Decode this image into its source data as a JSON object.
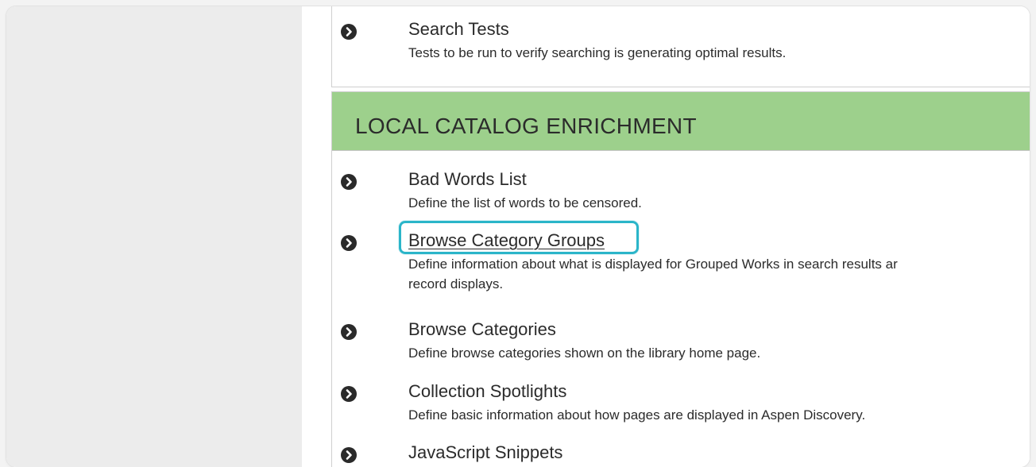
{
  "sections": {
    "search_tests": {
      "title": "Search Tests",
      "description": "Tests to be run to verify searching is generating optimal results."
    },
    "local_catalog_enrichment": {
      "header": "LOCAL CATALOG ENRICHMENT",
      "items": [
        {
          "title": "Bad Words List",
          "description": "Define the list of words to be censored."
        },
        {
          "title": "Browse Category Groups",
          "description_line1": "Define information about what is displayed for Grouped Works in search results ar",
          "description_line2": "record displays."
        },
        {
          "title": "Browse Categories",
          "description": "Define browse categories shown on the library home page."
        },
        {
          "title": "Collection Spotlights",
          "description": "Define basic information about how pages are displayed in Aspen Discovery."
        },
        {
          "title": "JavaScript Snippets"
        }
      ]
    }
  },
  "colors": {
    "section_header": "#9dd08c",
    "highlight": "#2bb5c9",
    "chevron": "#2a2a2a"
  },
  "icons": {
    "item_marker": "chevron-circle-right-icon"
  }
}
